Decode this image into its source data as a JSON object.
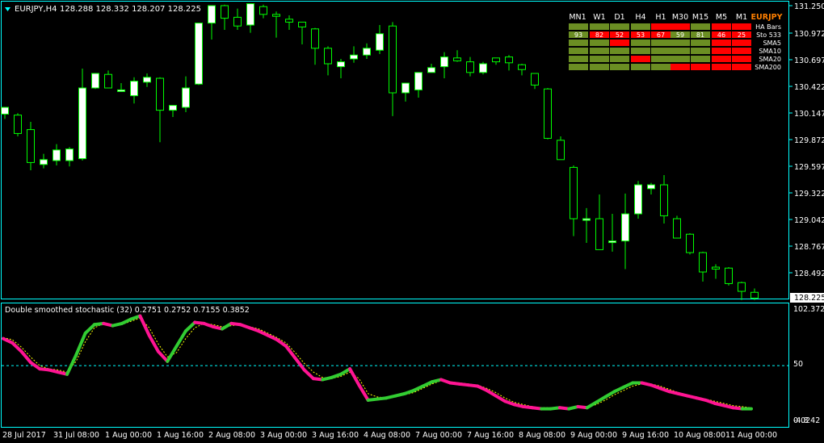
{
  "colors": {
    "background": "#000000",
    "frame": "#00FFFF",
    "bull_candle_body": "#FFFFFF",
    "bear_candle_body": "#000000",
    "candle_wick": "#00FF00",
    "stoch_up": "#32CD32",
    "stoch_down": "#FF1493",
    "signal_line": "#FFFF00",
    "level_line": "#00FFFF",
    "panel_green": "#6B8E23",
    "panel_red": "#FF0000",
    "symbol_text": "#FF7F00"
  },
  "main_header": {
    "symbol_tf": "EURJPY,H4",
    "ohlc": "128.288 128.332 128.207 128.225"
  },
  "price_axis": {
    "labels": [
      "131.250",
      "130.972",
      "130.697",
      "130.422",
      "130.147",
      "129.872",
      "129.597",
      "129.322",
      "129.042",
      "128.767",
      "128.492"
    ],
    "current_price": "128.225"
  },
  "time_axis": {
    "labels": [
      "28 Jul 2017",
      "31 Jul 08:00",
      "1 Aug 00:00",
      "1 Aug 16:00",
      "2 Aug 08:00",
      "3 Aug 00:00",
      "3 Aug 16:00",
      "4 Aug 08:00",
      "7 Aug 00:00",
      "7 Aug 16:00",
      "8 Aug 08:00",
      "9 Aug 00:00",
      "9 Aug 16:00",
      "10 Aug 08:00",
      "11 Aug 00:00"
    ]
  },
  "indicator": {
    "title": "Double smoothed stochastic (32) 0.2751 0.2752 0.7155 0.3852",
    "axis_top": "102.3727",
    "axis_mid": "50",
    "axis_bottom": "0.0242",
    "axis_bottom_overlay": "-4.8"
  },
  "trend_panel": {
    "symbol": "EURJPY",
    "timeframes": [
      "MN1",
      "W1",
      "D1",
      "H4",
      "H1",
      "M30",
      "M15",
      "M5",
      "M1"
    ],
    "rows": [
      {
        "label": "HA Bars",
        "cells": [
          "g",
          "g",
          "g",
          "g",
          "r",
          "r",
          "g",
          "r",
          "r"
        ],
        "values": [
          "",
          "",
          "",
          "",
          "",
          "",
          "",
          "",
          ""
        ]
      },
      {
        "label": "Sto 533",
        "cells": [
          "g",
          "r",
          "r",
          "r",
          "r",
          "g",
          "g",
          "r",
          "r"
        ],
        "values": [
          "93",
          "82",
          "52",
          "53",
          "67",
          "59",
          "81",
          "46",
          "25"
        ]
      },
      {
        "label": "SMA5",
        "cells": [
          "g",
          "g",
          "r",
          "g",
          "g",
          "g",
          "g",
          "r",
          "r"
        ],
        "values": [
          "",
          "",
          "",
          "",
          "",
          "",
          "",
          "",
          ""
        ]
      },
      {
        "label": "SMA10",
        "cells": [
          "g",
          "g",
          "g",
          "g",
          "g",
          "g",
          "g",
          "r",
          "r"
        ],
        "values": [
          "",
          "",
          "",
          "",
          "",
          "",
          "",
          "",
          ""
        ]
      },
      {
        "label": "SMA20",
        "cells": [
          "g",
          "g",
          "g",
          "r",
          "g",
          "g",
          "g",
          "r",
          "r"
        ],
        "values": [
          "",
          "",
          "",
          "",
          "",
          "",
          "",
          "",
          ""
        ]
      },
      {
        "label": "SMA200",
        "cells": [
          "g",
          "g",
          "g",
          "g",
          "g",
          "r",
          "r",
          "r",
          "r"
        ],
        "values": [
          "",
          "",
          "",
          "",
          "",
          "",
          "",
          "",
          ""
        ]
      }
    ]
  },
  "candles": [
    {
      "o": 130.13,
      "h": 130.2,
      "l": 130.08,
      "c": 130.2
    },
    {
      "o": 130.12,
      "h": 130.14,
      "l": 129.9,
      "c": 129.93
    },
    {
      "o": 129.97,
      "h": 130.05,
      "l": 129.55,
      "c": 129.63
    },
    {
      "o": 129.61,
      "h": 129.72,
      "l": 129.57,
      "c": 129.66
    },
    {
      "o": 129.65,
      "h": 129.82,
      "l": 129.6,
      "c": 129.76
    },
    {
      "o": 129.65,
      "h": 129.79,
      "l": 129.59,
      "c": 129.77
    },
    {
      "o": 129.67,
      "h": 130.6,
      "l": 129.65,
      "c": 130.4
    },
    {
      "o": 130.4,
      "h": 130.55,
      "l": 130.39,
      "c": 130.55
    },
    {
      "o": 130.54,
      "h": 130.58,
      "l": 130.4,
      "c": 130.4
    },
    {
      "o": 130.37,
      "h": 130.45,
      "l": 130.36,
      "c": 130.38
    },
    {
      "o": 130.32,
      "h": 130.51,
      "l": 130.24,
      "c": 130.47
    },
    {
      "o": 130.46,
      "h": 130.55,
      "l": 130.41,
      "c": 130.51
    },
    {
      "o": 130.5,
      "h": 130.51,
      "l": 129.84,
      "c": 130.17
    },
    {
      "o": 130.17,
      "h": 130.22,
      "l": 130.1,
      "c": 130.22
    },
    {
      "o": 130.2,
      "h": 130.52,
      "l": 130.15,
      "c": 130.4
    },
    {
      "o": 130.44,
      "h": 131.07,
      "l": 130.43,
      "c": 131.07
    },
    {
      "o": 131.07,
      "h": 131.25,
      "l": 130.9,
      "c": 131.25
    },
    {
      "o": 131.25,
      "h": 131.26,
      "l": 131.0,
      "c": 131.12
    },
    {
      "o": 131.13,
      "h": 131.22,
      "l": 131.0,
      "c": 131.04
    },
    {
      "o": 131.05,
      "h": 131.27,
      "l": 130.97,
      "c": 131.27
    },
    {
      "o": 131.24,
      "h": 131.26,
      "l": 131.12,
      "c": 131.16
    },
    {
      "o": 131.16,
      "h": 131.19,
      "l": 130.92,
      "c": 131.14
    },
    {
      "o": 131.11,
      "h": 131.15,
      "l": 131.0,
      "c": 131.08
    },
    {
      "o": 131.08,
      "h": 131.07,
      "l": 130.85,
      "c": 131.03
    },
    {
      "o": 131.01,
      "h": 131.02,
      "l": 130.64,
      "c": 130.81
    },
    {
      "o": 130.81,
      "h": 130.83,
      "l": 130.53,
      "c": 130.65
    },
    {
      "o": 130.62,
      "h": 130.7,
      "l": 130.5,
      "c": 130.67
    },
    {
      "o": 130.7,
      "h": 130.83,
      "l": 130.66,
      "c": 130.74
    },
    {
      "o": 130.74,
      "h": 130.86,
      "l": 130.7,
      "c": 130.81
    },
    {
      "o": 130.79,
      "h": 131.05,
      "l": 130.75,
      "c": 130.96
    },
    {
      "o": 131.04,
      "h": 131.08,
      "l": 130.11,
      "c": 130.35
    },
    {
      "o": 130.35,
      "h": 130.45,
      "l": 130.26,
      "c": 130.45
    },
    {
      "o": 130.38,
      "h": 130.54,
      "l": 130.3,
      "c": 130.56
    },
    {
      "o": 130.56,
      "h": 130.65,
      "l": 130.58,
      "c": 130.61
    },
    {
      "o": 130.62,
      "h": 130.77,
      "l": 130.5,
      "c": 130.72
    },
    {
      "o": 130.71,
      "h": 130.79,
      "l": 130.67,
      "c": 130.68
    },
    {
      "o": 130.67,
      "h": 130.72,
      "l": 130.52,
      "c": 130.56
    },
    {
      "o": 130.56,
      "h": 130.67,
      "l": 130.54,
      "c": 130.65
    },
    {
      "o": 130.71,
      "h": 130.71,
      "l": 130.64,
      "c": 130.67
    },
    {
      "o": 130.72,
      "h": 130.74,
      "l": 130.58,
      "c": 130.66
    },
    {
      "o": 130.64,
      "h": 130.65,
      "l": 130.53,
      "c": 130.59
    },
    {
      "o": 130.55,
      "h": 130.55,
      "l": 130.39,
      "c": 130.43
    },
    {
      "o": 130.39,
      "h": 130.4,
      "l": 129.87,
      "c": 129.88
    },
    {
      "o": 129.86,
      "h": 129.9,
      "l": 129.66,
      "c": 129.66
    },
    {
      "o": 129.58,
      "h": 129.6,
      "l": 128.87,
      "c": 129.05
    },
    {
      "o": 129.04,
      "h": 129.16,
      "l": 128.8,
      "c": 129.05
    },
    {
      "o": 129.05,
      "h": 129.3,
      "l": 128.8,
      "c": 128.73
    },
    {
      "o": 128.82,
      "h": 129.1,
      "l": 128.71,
      "c": 128.82
    },
    {
      "o": 128.82,
      "h": 129.31,
      "l": 128.53,
      "c": 129.1
    },
    {
      "o": 129.1,
      "h": 129.44,
      "l": 129.05,
      "c": 129.4
    },
    {
      "o": 129.36,
      "h": 129.42,
      "l": 129.3,
      "c": 129.4
    },
    {
      "o": 129.4,
      "h": 129.5,
      "l": 129.0,
      "c": 129.08
    },
    {
      "o": 129.05,
      "h": 129.08,
      "l": 128.85,
      "c": 128.85
    },
    {
      "o": 128.89,
      "h": 128.9,
      "l": 128.68,
      "c": 128.7
    },
    {
      "o": 128.7,
      "h": 128.71,
      "l": 128.4,
      "c": 128.5
    },
    {
      "o": 128.55,
      "h": 128.58,
      "l": 128.43,
      "c": 128.53
    },
    {
      "o": 128.54,
      "h": 128.55,
      "l": 128.36,
      "c": 128.38
    },
    {
      "o": 128.39,
      "h": 128.4,
      "l": 128.21,
      "c": 128.3
    },
    {
      "o": 128.29,
      "h": 128.33,
      "l": 128.21,
      "c": 128.23
    }
  ],
  "stoch_values": [
    75,
    71,
    63,
    53,
    47,
    46,
    44,
    42,
    60,
    80,
    88,
    89,
    87,
    89,
    93,
    96,
    78,
    63,
    54,
    68,
    82,
    90,
    89,
    86,
    84,
    89,
    88,
    85,
    82,
    78,
    74,
    68,
    57,
    46,
    38,
    37,
    39,
    42,
    47,
    32,
    18,
    19,
    20,
    22,
    24,
    27,
    31,
    35,
    37,
    34,
    33,
    32,
    31,
    27,
    22,
    17,
    14,
    12,
    11,
    10,
    10,
    11,
    10,
    12,
    11,
    16,
    21,
    26,
    30,
    34,
    34,
    32,
    29,
    26,
    24,
    22,
    20,
    18,
    15,
    13,
    11,
    10,
    10
  ],
  "signal_values": [
    76,
    74,
    67,
    58,
    50,
    47,
    46,
    44,
    54,
    72,
    85,
    89,
    88,
    88,
    91,
    94,
    85,
    70,
    58,
    62,
    75,
    85,
    89,
    88,
    86,
    87,
    88,
    86,
    84,
    80,
    76,
    71,
    62,
    52,
    44,
    39,
    38,
    40,
    44,
    38,
    24,
    21,
    20,
    21,
    23,
    25,
    29,
    33,
    36,
    35,
    34,
    33,
    32,
    29,
    25,
    20,
    16,
    14,
    12,
    11,
    11,
    11,
    11,
    11,
    11,
    14,
    18,
    23,
    27,
    31,
    33,
    33,
    31,
    28,
    25,
    23,
    21,
    19,
    17,
    15,
    13,
    12,
    11
  ]
}
